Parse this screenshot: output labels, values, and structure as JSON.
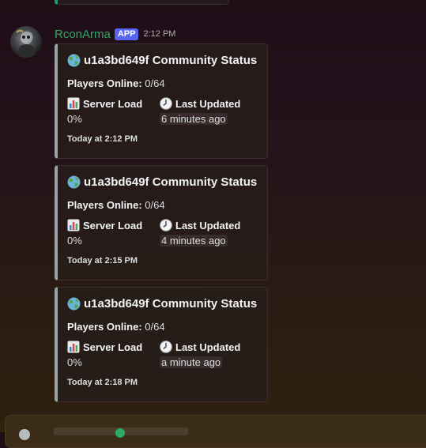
{
  "message": {
    "username": "RconArma",
    "badge": "APP",
    "time": "2:12 PM"
  },
  "embeds": [
    {
      "title": "u1a3bd649f Community Status",
      "players_label": "Players Online:",
      "players_value": "0/64",
      "load_label": "Server Load",
      "load_value": "0%",
      "updated_label": "Last Updated",
      "updated_value": "6 minutes ago",
      "footer": "Today at 2:12 PM"
    },
    {
      "title": "u1a3bd649f Community Status",
      "players_label": "Players Online:",
      "players_value": "0/64",
      "load_label": "Server Load",
      "load_value": "0%",
      "updated_label": "Last Updated",
      "updated_value": "4 minutes ago",
      "footer": "Today at 2:15 PM"
    },
    {
      "title": "u1a3bd649f Community Status",
      "players_label": "Players Online:",
      "players_value": "0/64",
      "load_label": "Server Load",
      "load_value": "0%",
      "updated_label": "Last Updated",
      "updated_value": "a minute ago",
      "footer": "Today at 2:18 PM"
    }
  ],
  "icons": {
    "title": "globe-icon",
    "load": "bar-chart-icon",
    "updated": "clock-icon"
  },
  "colors": {
    "username": "#2fa866",
    "badge": "#5865f2",
    "embed_border": "#9aa3a8"
  }
}
